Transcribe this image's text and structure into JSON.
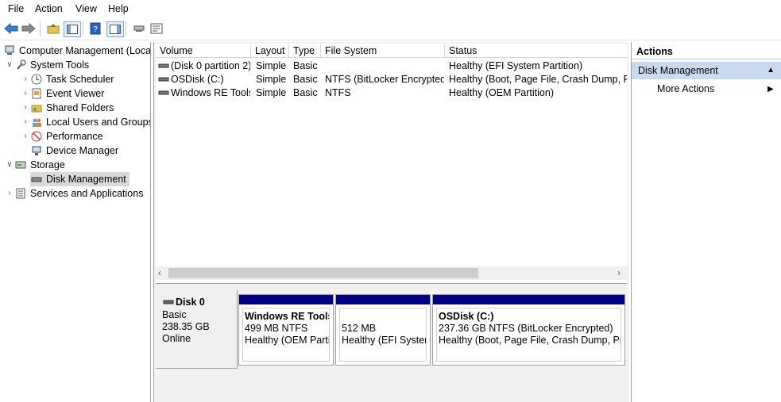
{
  "menu": [
    "File",
    "Action",
    "View",
    "Help"
  ],
  "tree": {
    "root": "Computer Management (Local",
    "system_tools": "System Tools",
    "task_scheduler": "Task Scheduler",
    "event_viewer": "Event Viewer",
    "shared_folders": "Shared Folders",
    "local_users": "Local Users and Groups",
    "performance": "Performance",
    "device_manager": "Device Manager",
    "storage": "Storage",
    "disk_management": "Disk Management",
    "services": "Services and Applications"
  },
  "volumes": {
    "headers": [
      "Volume",
      "Layout",
      "Type",
      "File System",
      "Status"
    ],
    "rows": [
      [
        "(Disk 0 partition 2)",
        "Simple",
        "Basic",
        "",
        "Healthy (EFI System Partition)"
      ],
      [
        "OSDisk (C:)",
        "Simple",
        "Basic",
        "NTFS (BitLocker Encrypted)",
        "Healthy (Boot, Page File, Crash Dump, Prim"
      ],
      [
        "Windows RE Tools",
        "Simple",
        "Basic",
        "NTFS",
        "Healthy (OEM Partition)"
      ]
    ]
  },
  "disk": {
    "name": "Disk 0",
    "type": "Basic",
    "size": "238.35 GB",
    "state": "Online",
    "partitions": [
      {
        "title": "Windows RE Tools",
        "size": "499 MB NTFS",
        "status": "Healthy (OEM Partit"
      },
      {
        "title": "",
        "size": "512 MB",
        "status": "Healthy (EFI System"
      },
      {
        "title": "OSDisk  (C:)",
        "size": "237.36 GB NTFS (BitLocker Encrypted)",
        "status": "Healthy (Boot, Page File, Crash Dump, Prim"
      }
    ]
  },
  "actions": {
    "title": "Actions",
    "section": "Disk Management",
    "more": "More Actions"
  },
  "colors": {
    "partition_header": "#000080",
    "selected_bg": "#d9d9d9",
    "actions_section_bg": "#c9d9ee"
  }
}
